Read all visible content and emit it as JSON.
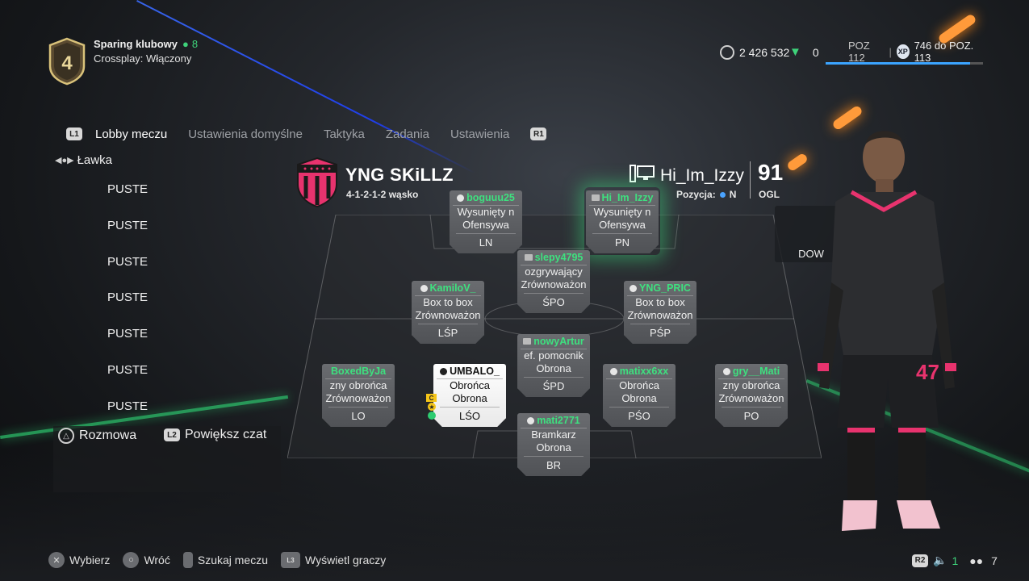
{
  "header": {
    "division": "4",
    "mode_title": "Sparing klubowy",
    "mode_players": "8",
    "crossplay": "Crossplay: Włączony",
    "coins": "2 426 532",
    "points": "0",
    "level": "POZ 112",
    "xp_progress": "746 do POZ. 113",
    "level_progress_pct": 92
  },
  "tabs": {
    "l1": "L1",
    "r1": "R1",
    "items": [
      "Lobby meczu",
      "Ustawienia domyślne",
      "Taktyka",
      "Zadania",
      "Ustawienia"
    ]
  },
  "bench": {
    "title": "Ławka",
    "items": [
      "PUSTE",
      "PUSTE",
      "PUSTE",
      "PUSTE",
      "PUSTE",
      "PUSTE",
      "PUSTE"
    ]
  },
  "chat": {
    "talk": "Rozmowa",
    "zoom_btn": "L2",
    "zoom": "Powiększ czat"
  },
  "team": {
    "name": "YNG SKiLLZ",
    "formation": "4-1-2-1-2 wąsko",
    "crest_color": "#e8336e"
  },
  "player": {
    "name": "Hi_Im_Izzy",
    "position_label": "Pozycja:",
    "position": "N",
    "ovr": "91",
    "ovr_label": "OGL"
  },
  "cards": {
    "ln": {
      "name": "boguuu25",
      "r1": "Wysunięty n",
      "r2": "Ofensywa",
      "pos": "LN"
    },
    "pn": {
      "name": "Hi_Im_Izzy",
      "r1": "Wysunięty n",
      "r2": "Ofensywa",
      "pos": "PN"
    },
    "spo": {
      "name": "slepy4795",
      "r1": "ozgrywający",
      "r2": "Zrównoważon",
      "pos": "ŚPO"
    },
    "lsp": {
      "name": "KamiloV_",
      "r1": "Box to box",
      "r2": "Zrównoważon",
      "pos": "LŚP"
    },
    "psp": {
      "name": "YNG_PRIC",
      "r1": "Box to box",
      "r2": "Zrównoważon",
      "pos": "PŚP"
    },
    "spd": {
      "name": "nowyArtur",
      "r1": "ef. pomocnik",
      "r2": "Obrona",
      "pos": "ŚPD"
    },
    "lo": {
      "name": "BoxedByJa",
      "r1": "zny obrońca",
      "r2": "Zrównoważon",
      "pos": "LO"
    },
    "lso": {
      "name": "UMBALO_",
      "r1": "Obrońca",
      "r2": "Obrona",
      "pos": "LŚO"
    },
    "pso": {
      "name": "matixx6xx",
      "r1": "Obrońca",
      "r2": "Obrona",
      "pos": "PŚO"
    },
    "po": {
      "name": "gry__Mati",
      "r1": "zny obrońca",
      "r2": "Zrównoważon",
      "pos": "PO"
    },
    "br": {
      "name": "mati2771",
      "r1": "Bramkarz",
      "r2": "Obrona",
      "pos": "BR"
    }
  },
  "lso_badges": {
    "captain": "C"
  },
  "side_panel": {
    "label": "DOW"
  },
  "footer": {
    "select": "Wybierz",
    "back": "Wróć",
    "search": "Szukaj meczu",
    "l3": "L3",
    "show": "Wyświetl graczy",
    "r2": "R2",
    "voice_count": "1",
    "players_count": "7"
  }
}
